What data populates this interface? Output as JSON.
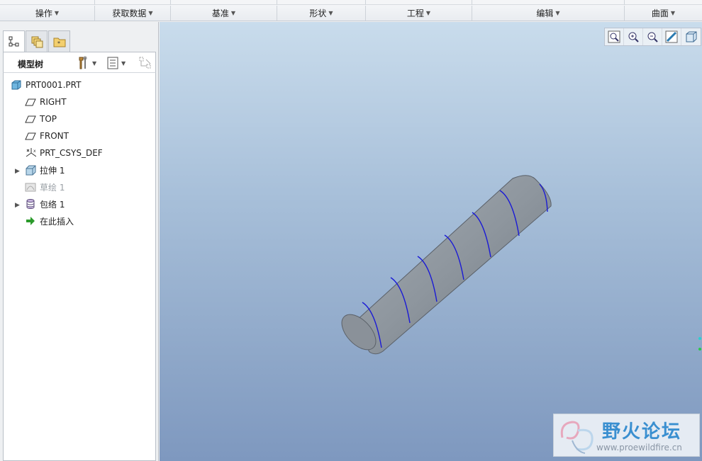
{
  "ribbon": {
    "groups": [
      {
        "label": "操作"
      },
      {
        "label": "获取数据"
      },
      {
        "label": "基准"
      },
      {
        "label": "形状"
      },
      {
        "label": "工程"
      },
      {
        "label": "编辑"
      },
      {
        "label": "曲面"
      }
    ]
  },
  "panel": {
    "tabs": [
      "model-tree-tab",
      "layer-tab",
      "folder-tab"
    ],
    "tree_title": "模型树"
  },
  "tree": {
    "nodes": [
      {
        "label": "PRT0001.PRT",
        "icon": "part-icon"
      },
      {
        "label": "RIGHT",
        "icon": "datum-plane-icon"
      },
      {
        "label": "TOP",
        "icon": "datum-plane-icon"
      },
      {
        "label": "FRONT",
        "icon": "datum-plane-icon"
      },
      {
        "label": "PRT_CSYS_DEF",
        "icon": "csys-icon"
      },
      {
        "label": "拉伸 1",
        "icon": "extrude-icon"
      },
      {
        "label": "草绘 1",
        "icon": "sketch-icon",
        "state": "disabled"
      },
      {
        "label": "包络 1",
        "icon": "wrap-icon"
      },
      {
        "label": "在此插入",
        "icon": "insert-arrow-icon"
      }
    ]
  },
  "viewport": {
    "tools": [
      "refit-icon",
      "zoom-in-icon",
      "zoom-out-icon",
      "repaint-icon",
      "view-cube-icon"
    ],
    "watermark_name": "野火论坛",
    "watermark_url": "www.proewildfire.cn"
  },
  "colors": {
    "model_body": "#8e969e",
    "wrap_curve": "#1a1ad6",
    "viewport_top": "#c9dcec",
    "viewport_bottom": "#7e98bf"
  }
}
